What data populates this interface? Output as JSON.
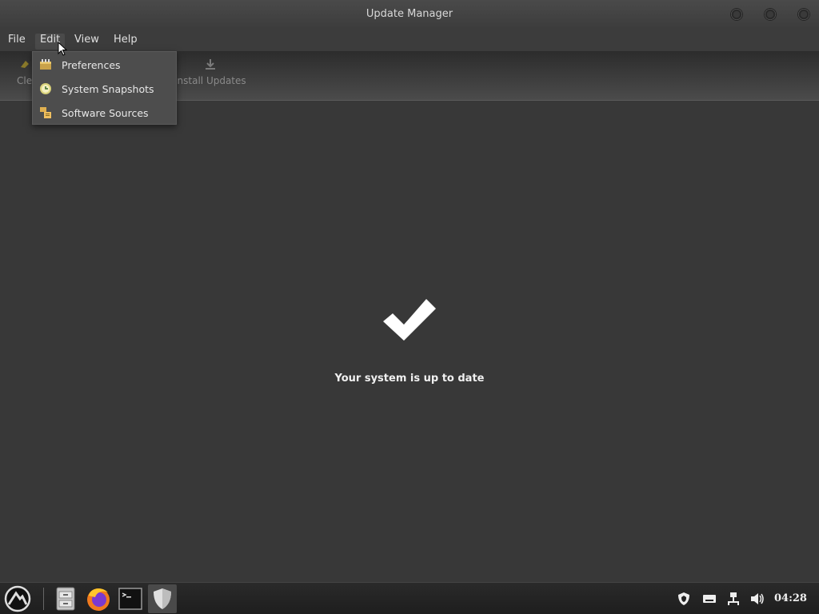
{
  "window": {
    "title": "Update Manager"
  },
  "menubar": {
    "items": [
      "File",
      "Edit",
      "View",
      "Help"
    ],
    "active": "Edit"
  },
  "toolbar": {
    "clear_label": "Cle",
    "install_label": "Install Updates"
  },
  "edit_menu": {
    "items": [
      {
        "label": "Preferences",
        "icon": "preferences-icon"
      },
      {
        "label": "System Snapshots",
        "icon": "snapshot-clock-icon"
      },
      {
        "label": "Software Sources",
        "icon": "software-sources-icon"
      }
    ]
  },
  "status": {
    "message": "Your system is up to date",
    "icon": "checkmark-icon"
  },
  "taskbar": {
    "apps": [
      "start-menu-icon",
      "file-manager-icon",
      "firefox-icon",
      "terminal-icon",
      "update-manager-shield-icon"
    ],
    "tray": [
      "shield-tray-icon",
      "keyboard-icon",
      "network-icon",
      "volume-icon"
    ],
    "clock": "04:28"
  },
  "colors": {
    "background": "#383838",
    "menu_bg": "#4d4d4d",
    "text": "#e6e6e6"
  }
}
